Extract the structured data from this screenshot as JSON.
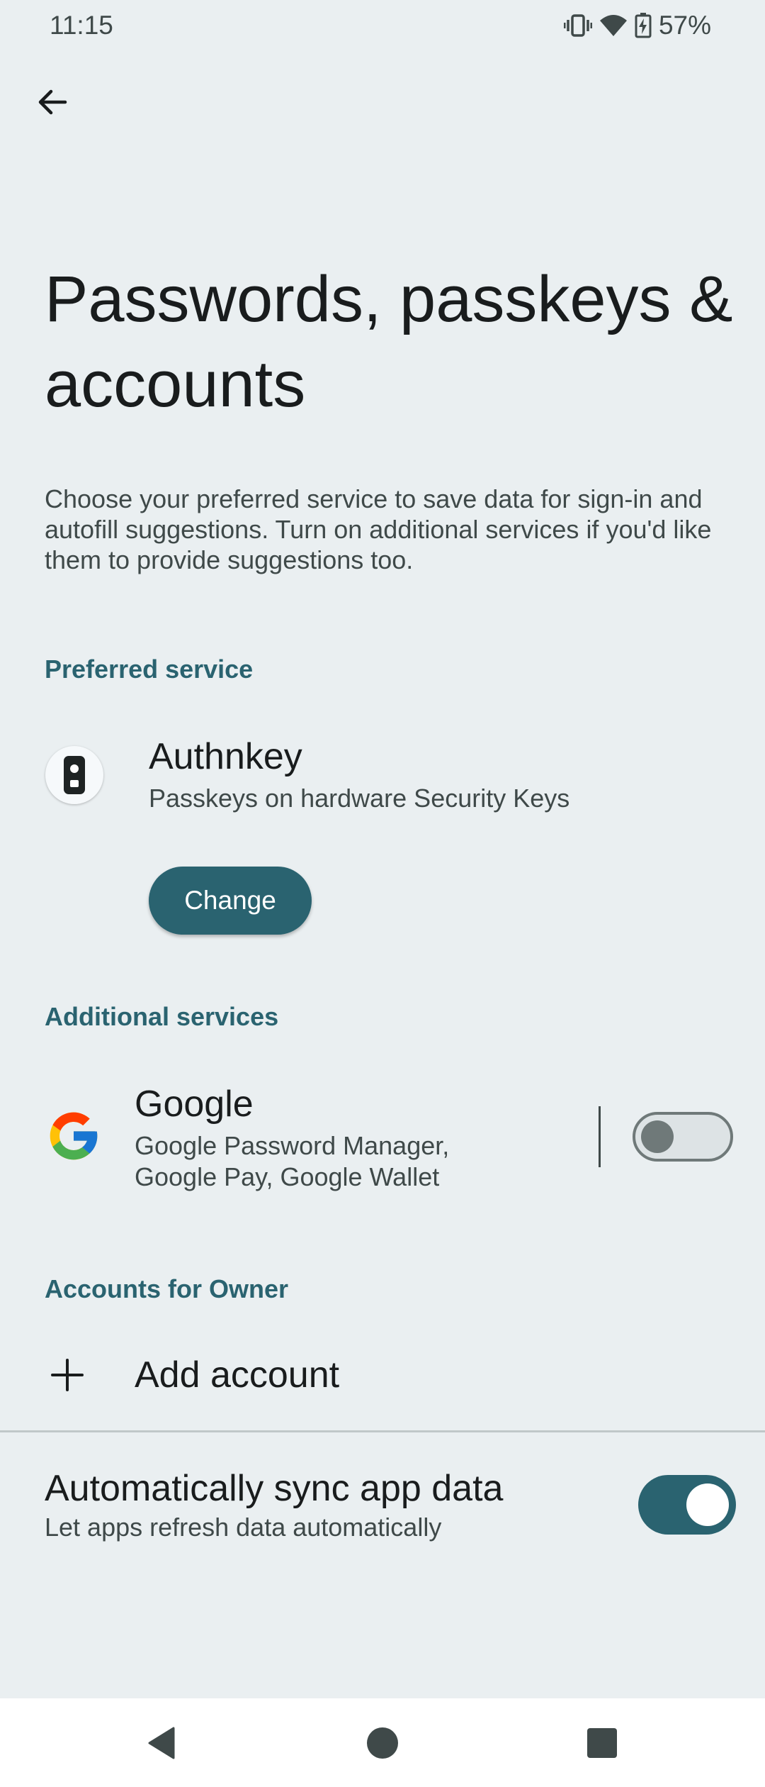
{
  "status_bar": {
    "time": "11:15",
    "battery": "57%",
    "icons": [
      "vibrate-icon",
      "wifi-icon",
      "battery-charging-icon"
    ]
  },
  "header": {
    "back_icon": "arrow-back-icon",
    "title": "Passwords, passkeys & accounts"
  },
  "description": "Choose your preferred service to save data for sign-in and autofill suggestions. Turn on additional services if you'd like them to provide suggestions too.",
  "preferred_service": {
    "header": "Preferred service",
    "name": "Authnkey",
    "subtitle": "Passkeys on hardware Security Keys",
    "icon": "security-key-icon",
    "change_button": "Change"
  },
  "additional_services": {
    "header": "Additional services",
    "items": [
      {
        "name": "Google",
        "subtitle_line1": "Google Password Manager,",
        "subtitle_line2": "Google Pay, Google Wallet",
        "icon": "google-logo-icon",
        "enabled": false
      }
    ]
  },
  "accounts": {
    "header": "Accounts for Owner",
    "add_account": "Add account",
    "add_icon": "plus-icon"
  },
  "sync": {
    "title": "Automatically sync app data",
    "subtitle": "Let apps refresh data automatically",
    "enabled": true
  },
  "nav_bar": {
    "icons": [
      "back-triangle-icon",
      "home-circle-icon",
      "recents-square-icon"
    ]
  },
  "colors": {
    "background": "#EAEFF1",
    "accent": "#2A6370",
    "text_primary": "#191C1D",
    "text_secondary": "#3F4949"
  }
}
